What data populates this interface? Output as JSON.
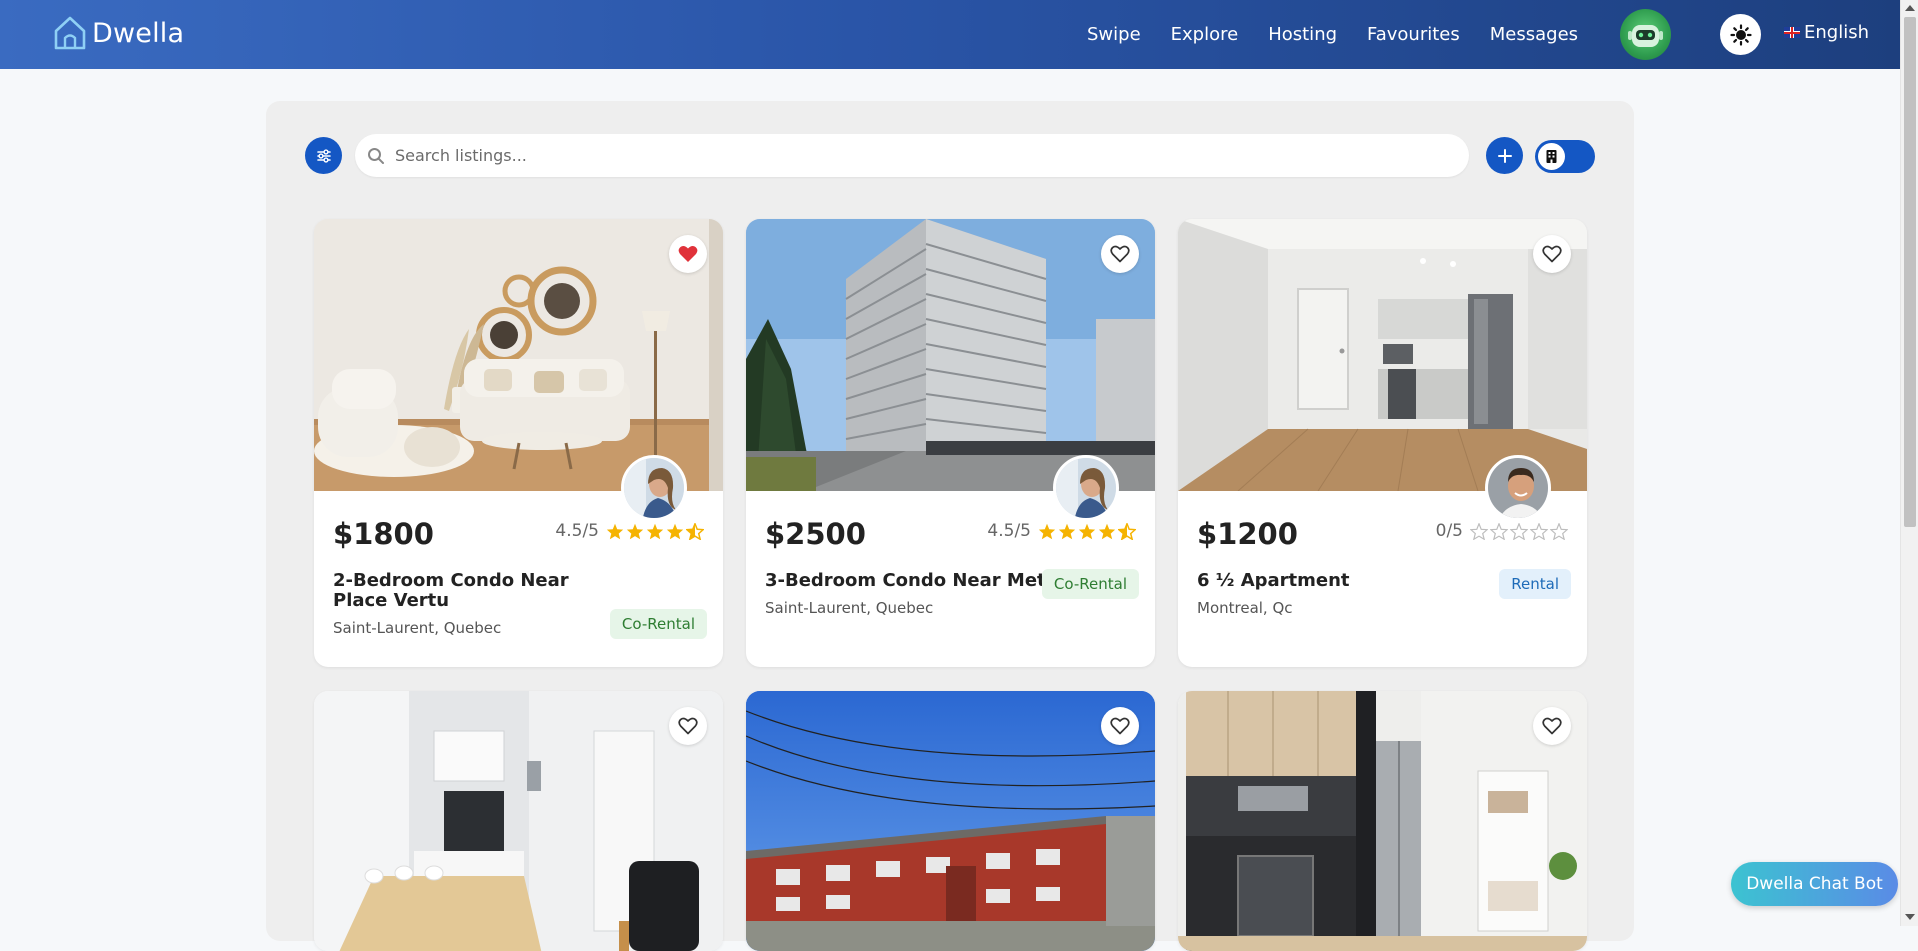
{
  "brand": {
    "name": "Dwella"
  },
  "nav": {
    "links": [
      "Swipe",
      "Explore",
      "Hosting",
      "Favourites",
      "Messages"
    ],
    "language": "English"
  },
  "search": {
    "placeholder": "Search listings..."
  },
  "listings": [
    {
      "price": "$1800",
      "rating": "4.5/5",
      "stars": 4.5,
      "title": "2-Bedroom Condo Near Place Vertu",
      "location": "Saint-Laurent, Quebec",
      "type": "Co-Rental",
      "favorited": true,
      "image": "living-room-photo",
      "host": "host-woman"
    },
    {
      "price": "$2500",
      "rating": "4.5/5",
      "stars": 4.5,
      "title": "3-Bedroom Condo Near Metro",
      "location": "Saint-Laurent, Quebec",
      "type": "Co-Rental",
      "favorited": false,
      "image": "tower-building-photo",
      "host": "host-woman"
    },
    {
      "price": "$1200",
      "rating": "0/5",
      "stars": 0,
      "title": "6 ½ Apartment",
      "location": "Montreal, Qc",
      "type": "Rental",
      "favorited": false,
      "image": "kitchen-hallway-photo",
      "host": "host-man"
    },
    {
      "favorited": false,
      "image": "dining-room-photo"
    },
    {
      "favorited": false,
      "image": "brick-building-photo"
    },
    {
      "favorited": false,
      "image": "modern-kitchen-photo"
    }
  ],
  "chatbot": {
    "label": "Dwella Chat Bot"
  },
  "colors": {
    "nav_start": "#3a6bc1",
    "nav_end": "#1d3f7e",
    "primary": "#1457c4",
    "star": "#f5b301",
    "heart": "#e0323a",
    "co_rental_bg": "#e6f5e8",
    "co_rental_text": "#2e7d32",
    "rental_bg": "#e3f0fb",
    "rental_text": "#1e6bb8"
  }
}
